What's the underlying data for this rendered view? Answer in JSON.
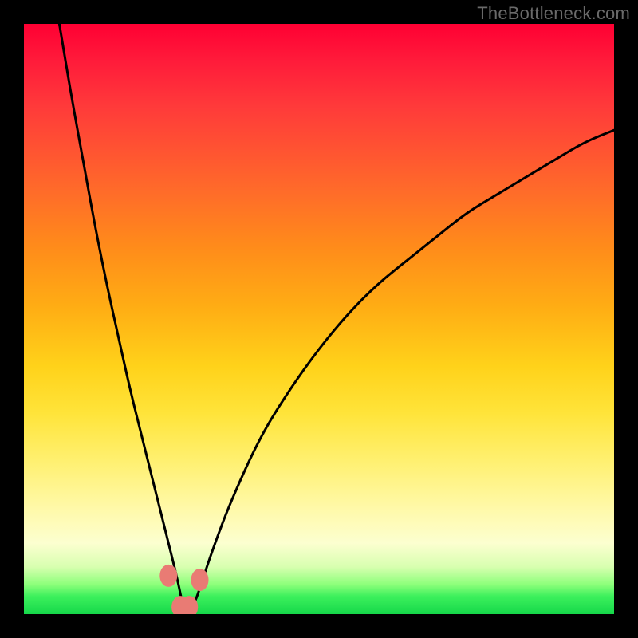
{
  "watermark": "TheBottleneck.com",
  "colors": {
    "background": "#000000",
    "curve": "#000000",
    "marker": "#e97b74",
    "gradient_top": "#ff0033",
    "gradient_bottom": "#16d84a"
  },
  "chart_data": {
    "type": "line",
    "title": "",
    "xlabel": "",
    "ylabel": "",
    "xlim": [
      0,
      100
    ],
    "ylim": [
      0,
      100
    ],
    "grid": false,
    "legend": false,
    "annotations": [
      "TheBottleneck.com"
    ],
    "note": "V-shaped bottleneck curve over a vertical red→green gradient. Minimum sits near x≈27, y≈1. Left branch rises steeply to the top edge near x≈6; right branch rises with decreasing slope, reaching y≈82 at x=100. Small salmon markers cluster around the minimum. Axes are unlabeled; values are normalized 0–100 estimates from pixel position.",
    "series": [
      {
        "name": "bottleneck-curve",
        "x": [
          6,
          8,
          10,
          12,
          14,
          16,
          18,
          20,
          22,
          24,
          26,
          27,
          28,
          29,
          30,
          32,
          35,
          40,
          45,
          50,
          55,
          60,
          65,
          70,
          75,
          80,
          85,
          90,
          95,
          100
        ],
        "y": [
          100,
          88,
          77,
          66,
          56,
          47,
          38,
          30,
          22,
          14,
          6,
          1,
          1,
          2,
          5,
          11,
          19,
          30,
          38,
          45,
          51,
          56,
          60,
          64,
          68,
          71,
          74,
          77,
          80,
          82
        ]
      }
    ],
    "markers": [
      {
        "x": 24.5,
        "y": 6.5
      },
      {
        "x": 26.5,
        "y": 1.2
      },
      {
        "x": 28.0,
        "y": 1.2
      },
      {
        "x": 29.8,
        "y": 5.8
      }
    ]
  }
}
